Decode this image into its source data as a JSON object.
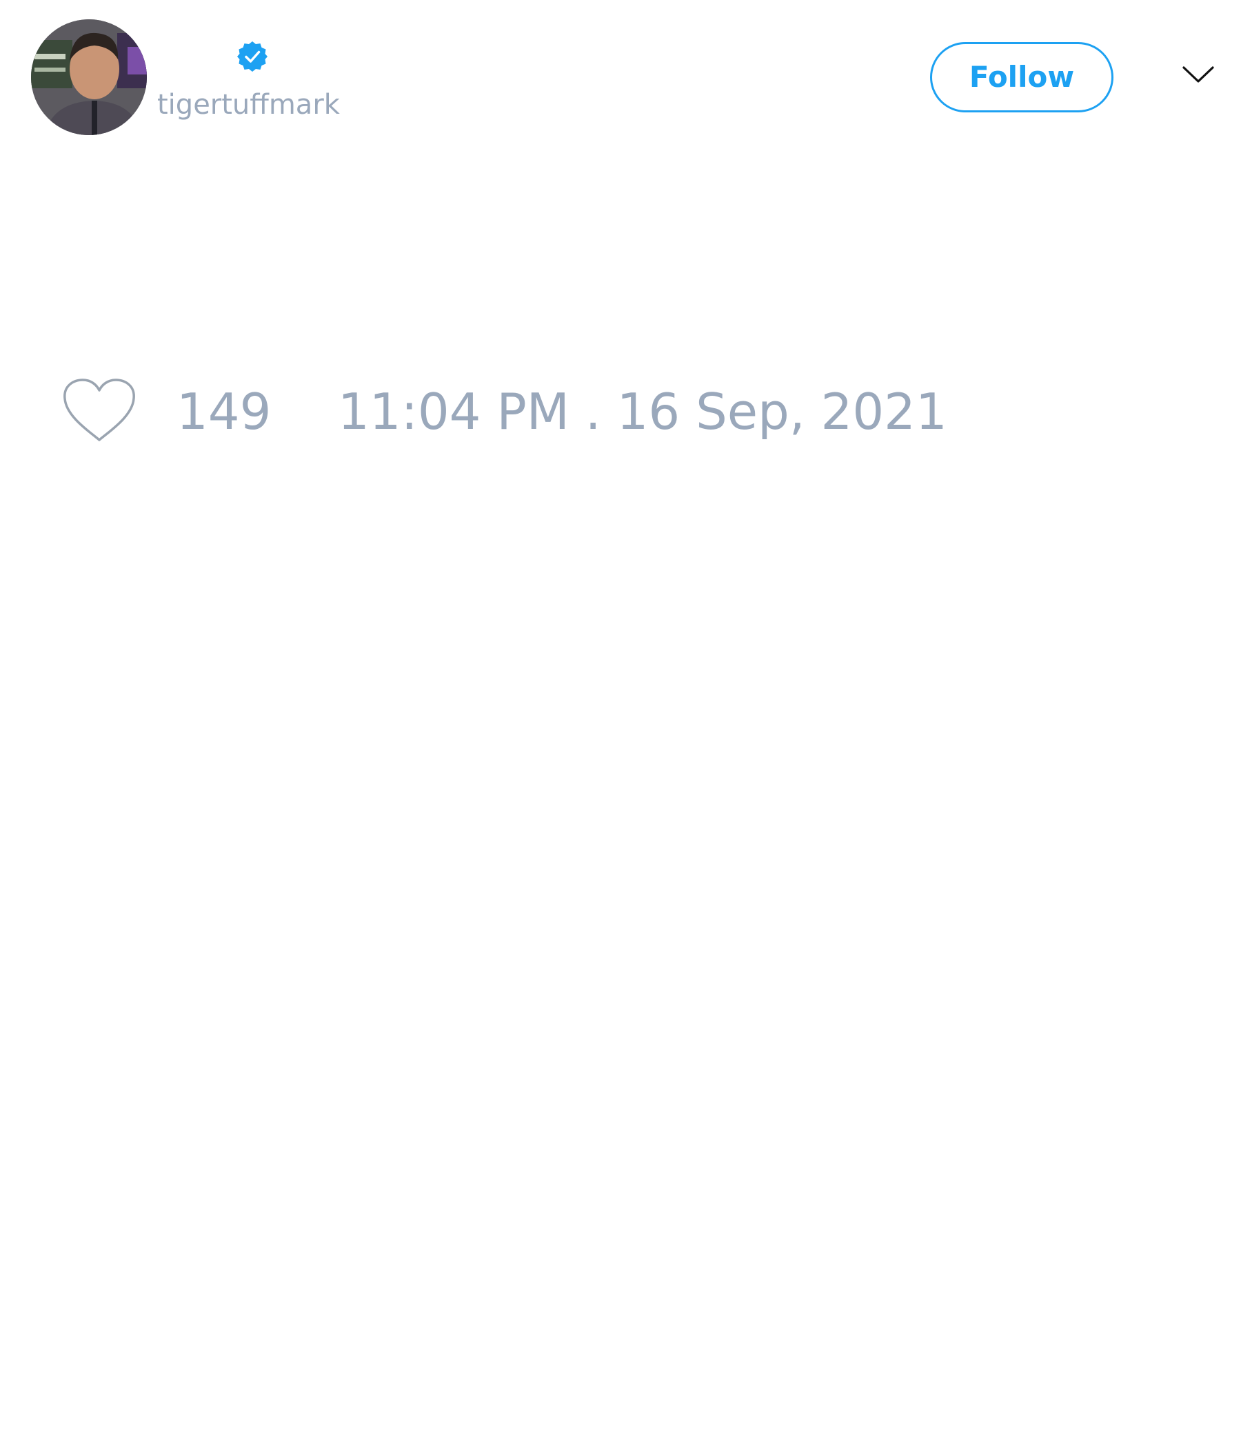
{
  "tweet": {
    "author": {
      "handle": "tigertuffmark",
      "verified": true,
      "avatar_icon": "profile-photo"
    },
    "follow_label": "Follow",
    "menu_icon": "chevron-down-icon",
    "like_icon": "heart-icon",
    "like_count": "149",
    "timestamp": "11:04 PM . 16 Sep, 2021"
  },
  "colors": {
    "accent": "#1da1f2",
    "muted_text": "#9aa8bb",
    "icon_gray": "#9aa4b0",
    "chevron": "#111111",
    "background": "#ffffff"
  }
}
